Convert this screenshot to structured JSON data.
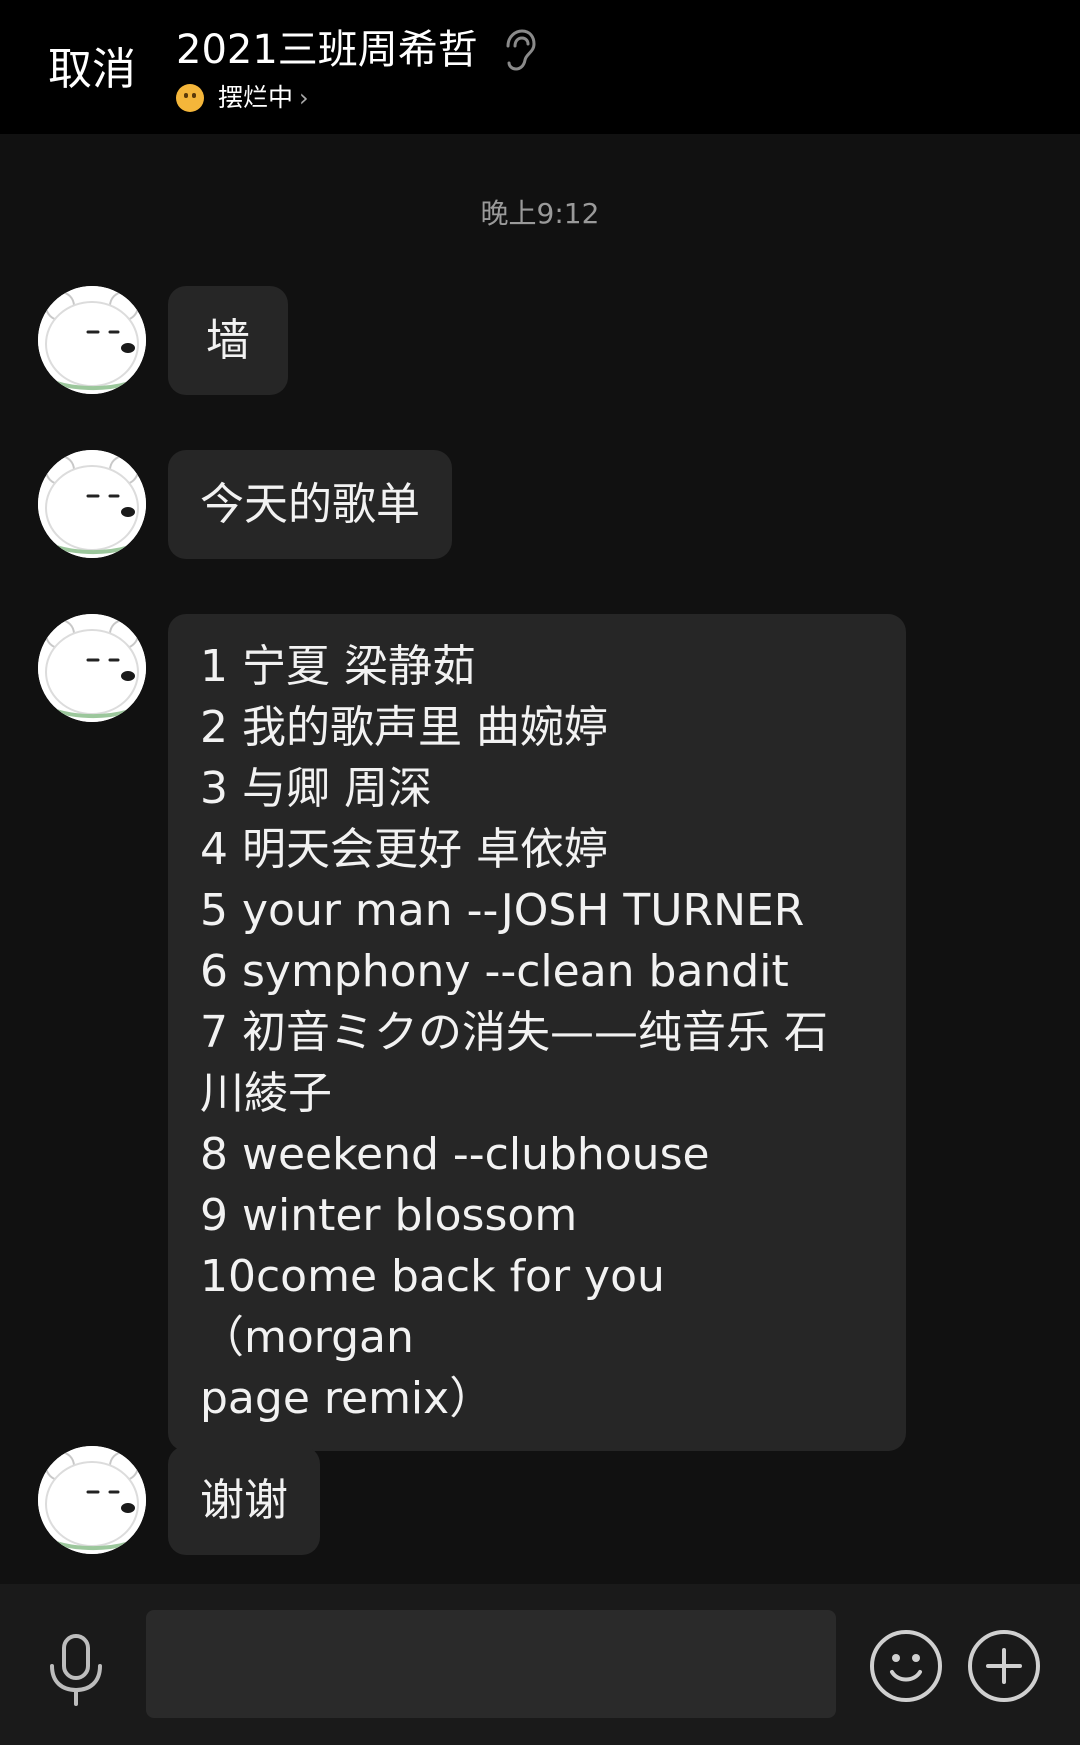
{
  "header": {
    "cancel_label": "取消",
    "title": "2021三班周希哲",
    "status_text": "摆烂中",
    "status_chevron": "›",
    "icons": [
      "ear-icon",
      "status-emoji-icon"
    ]
  },
  "chat": {
    "timestamp": "晚上9:12",
    "messages": [
      {
        "text": "墙"
      },
      {
        "text": "今天的歌单"
      },
      {
        "lines": [
          "1 宁夏 梁静茹",
          "2 我的歌声里 曲婉婷",
          "3 与卿 周深",
          "4 明天会更好 卓依婷",
          "5 your man --JOSH TURNER",
          "6 symphony --clean bandit",
          "7 初音ミクの消失——纯音乐 石",
          "川綾子",
          "8 weekend --clubhouse",
          "9 winter blossom",
          "10come back for you（morgan",
          "page remix）"
        ]
      },
      {
        "text": "谢谢"
      }
    ]
  },
  "input_bar": {
    "field_value": "",
    "icons": [
      "microphone-icon",
      "emoji-icon",
      "plus-icon"
    ]
  },
  "colors": {
    "background": "#111111",
    "bubble": "#262626",
    "header": "#000000",
    "input_bar": "#1a1a1a"
  }
}
